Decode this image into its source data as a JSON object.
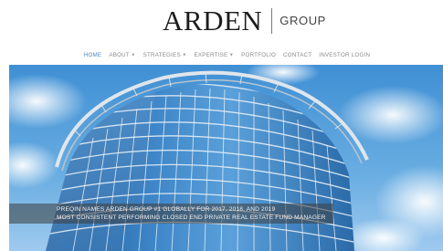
{
  "logo": {
    "main": "ARDEN",
    "sub": "GROUP"
  },
  "nav": {
    "items": [
      {
        "label": "HOME",
        "active": true
      },
      {
        "label": "ABOUT",
        "dropdown": true
      },
      {
        "label": "STRATEGIES",
        "dropdown": true
      },
      {
        "label": "EXPERTISE",
        "dropdown": true
      },
      {
        "label": "PORTFOLIO"
      },
      {
        "label": "CONTACT"
      },
      {
        "label": "INVESTOR LOGIN"
      }
    ],
    "active_color": "#4a86c5",
    "text_color": "#8a8a8a"
  },
  "hero": {
    "image": "glass-office-building-blue-sky",
    "caption": {
      "line1": "PREQIN NAMES ARDEN GROUP #1 GLOBALLY FOR 2017, 2018, AND 2019",
      "line2": "MOST CONSISTENT PERFORMING CLOSED END PRIVATE REAL ESTATE FUND MANAGER"
    }
  },
  "colors": {
    "sky": "#4f9ad8",
    "glass": "#2f6fb0",
    "frame": "#cfd8e0"
  }
}
